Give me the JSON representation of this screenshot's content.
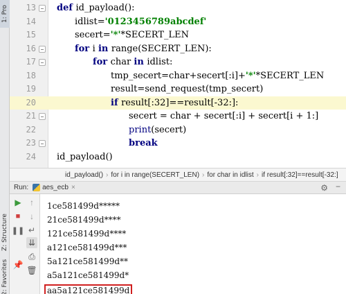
{
  "sidebar": {
    "project_tab": "1: Pro",
    "structure_tab": "Z: Structure",
    "favorites_tab": "2: Favorites"
  },
  "editor": {
    "lines": [
      {
        "num": "13",
        "segments": [
          {
            "t": "def ",
            "c": "kw"
          },
          {
            "t": "id_payload():",
            "c": ""
          }
        ]
      },
      {
        "num": "14",
        "segments": [
          {
            "t": "idlist=",
            "c": ""
          },
          {
            "t": "'0123456789abcdef'",
            "c": "str"
          }
        ]
      },
      {
        "num": "15",
        "segments": [
          {
            "t": "secert=",
            "c": ""
          },
          {
            "t": "'*'",
            "c": "str"
          },
          {
            "t": "*SECERT_LEN",
            "c": ""
          }
        ]
      },
      {
        "num": "16",
        "segments": [
          {
            "t": "for ",
            "c": "kw"
          },
          {
            "t": "i ",
            "c": ""
          },
          {
            "t": "in ",
            "c": "kw"
          },
          {
            "t": "range(SECERT_LEN):",
            "c": ""
          }
        ]
      },
      {
        "num": "17",
        "segments": [
          {
            "t": "for ",
            "c": "kw"
          },
          {
            "t": "char ",
            "c": ""
          },
          {
            "t": "in ",
            "c": "kw"
          },
          {
            "t": "idlist:",
            "c": ""
          }
        ]
      },
      {
        "num": "18",
        "segments": [
          {
            "t": "tmp_secert=char+secert[:i]+",
            "c": ""
          },
          {
            "t": "'*'",
            "c": "str"
          },
          {
            "t": "*SECERT_LEN",
            "c": ""
          }
        ]
      },
      {
        "num": "19",
        "segments": [
          {
            "t": "result=send_request(tmp_secert)",
            "c": ""
          }
        ]
      },
      {
        "num": "20",
        "segments": [
          {
            "t": "if ",
            "c": "kw"
          },
          {
            "t": "result[:32]==result[-32:]:",
            "c": ""
          }
        ]
      },
      {
        "num": "21",
        "segments": [
          {
            "t": "secert = char + secert[:i] + secert[i + 1:]",
            "c": ""
          }
        ]
      },
      {
        "num": "22",
        "segments": [
          {
            "t": "print",
            "c": "fn"
          },
          {
            "t": "(secert)",
            "c": ""
          }
        ]
      },
      {
        "num": "23",
        "segments": [
          {
            "t": "break",
            "c": "kw"
          }
        ]
      },
      {
        "num": "24",
        "segments": [
          {
            "t": "id_payload()",
            "c": ""
          }
        ]
      }
    ]
  },
  "breadcrumb": {
    "items": [
      "id_payload()",
      "for i in range(SECERT_LEN)",
      "for char in idlist",
      "if result[:32]==result[-32:]"
    ],
    "separator": "›"
  },
  "run": {
    "label": "Run:",
    "tab_name": "aes_ecb",
    "output_cut": "--- ---- -----",
    "output": [
      "1ce581499d*****",
      "21ce581499d****",
      "121ce581499d****",
      "a121ce581499d***",
      "5a121ce581499d**",
      "a5a121ce581499d*",
      "aa5a121ce581499d"
    ]
  },
  "colors": {
    "keyword": "#000080",
    "string": "#008000",
    "highlight_line": "#fbf8d0",
    "answer_box": "#d02020"
  },
  "icons": {
    "run": "play-icon",
    "scroll_up": "arrow-up-icon",
    "scroll_down": "arrow-down-icon",
    "stop": "stop-icon",
    "wrap": "soft-wrap-icon",
    "pause": "pause-icon",
    "scroll_end": "scroll-to-end-icon",
    "print": "print-icon",
    "settings": "gear-icon",
    "pin": "pin-icon",
    "delete": "trash-icon",
    "minimize": "minimize-icon"
  }
}
